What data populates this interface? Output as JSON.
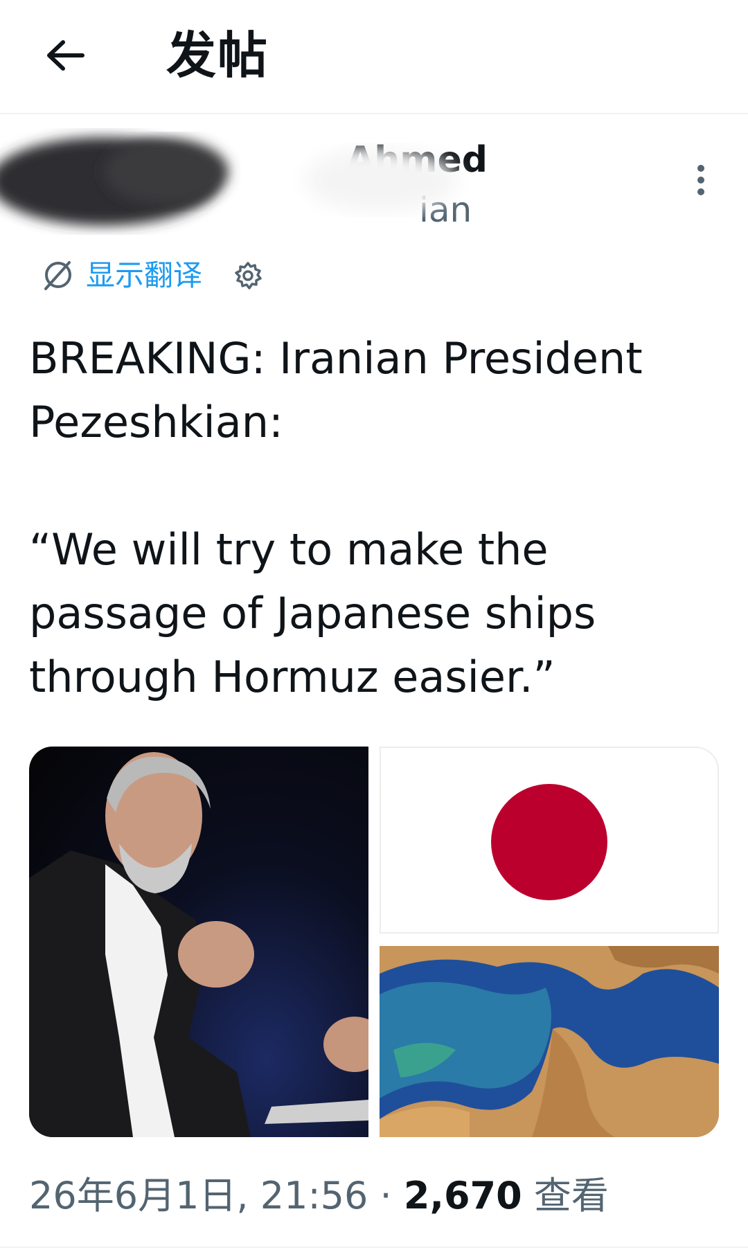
{
  "header": {
    "title": "发帖",
    "back_icon": "arrow-left-icon"
  },
  "author": {
    "name": "Ahmed",
    "handle": "ian",
    "more_icon": "more-vertical-icon"
  },
  "translate": {
    "label": "显示翻译",
    "icon": "translate-icon",
    "settings_icon": "gear-icon"
  },
  "tweet": {
    "text": "BREAKING: Iranian President\nPezeshkian:\n\n“We will try to make the\npassage of Japanese ships\nthrough Hormuz easier.”"
  },
  "meta": {
    "date": "26年6月1日, 21:56",
    "separator": "·",
    "views_count": "2,670",
    "views_label": "查看"
  },
  "colors": {
    "accent": "#1d9bf0",
    "secondary_text": "#536471",
    "flag_red": "#bc002d"
  }
}
